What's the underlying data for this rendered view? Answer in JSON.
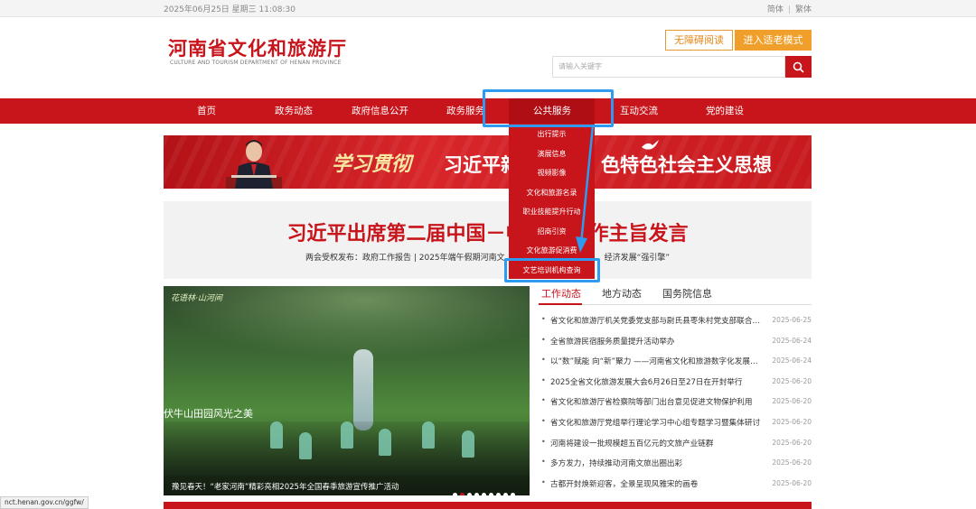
{
  "topbar": {
    "date": "2025年06月25日 星期三 11:08:30",
    "lang_simplified": "简体",
    "lang_separator": "|",
    "lang_traditional": "繁体"
  },
  "header": {
    "title": "河南省文化和旅游厅",
    "subtitle": "CULTURE AND TOURISM DEPARTMENT OF HENAN PROVINCE",
    "accessible_btn": "无障碍阅读",
    "elder_btn": "进入适老模式",
    "search_placeholder": "请输入关键字",
    "search_icon": "search-icon"
  },
  "nav": {
    "items": [
      "首页",
      "政务动态",
      "政府信息公开",
      "政务服务",
      "公共服务",
      "互动交流",
      "党的建设"
    ],
    "active": "公共服务"
  },
  "dropdown": {
    "items": [
      "出行提示",
      "演展信息",
      "视频影像",
      "文化和旅游名录",
      "职业技能提升行动",
      "招商引资",
      "文化旅游促消费",
      "文艺培训机构查询"
    ],
    "highlighted": "文艺培训机构查询"
  },
  "banner": {
    "calligraphy": "学习贯彻",
    "slogan_left": "习近平新",
    "slogan_right": "色特色社会主义思想"
  },
  "headline": {
    "title_left": "习近平出席第二届中国－中",
    "title_right": "工作主旨发言",
    "sub_left": "两会受权发布：政府工作报告 | 2025年端午假期河南文",
    "sub_right": "经济发展“强引擎”"
  },
  "slider": {
    "overlay_tag": "花语林·山河间",
    "caption_script": "伏牛山田园风光之美",
    "caption": "豫见春天！“老家河南”精彩亮相2025年全国春季旅游宣传推广活动",
    "dots": 9,
    "active_dot": 1
  },
  "news": {
    "tabs": [
      "工作动态",
      "地方动态",
      "国务院信息"
    ],
    "active_tab": "工作动态",
    "items": [
      {
        "title": "省文化和旅游厅机关党委党支部与尉氏县枣朱村党支部联合开展主题党日活动",
        "date": "2025-06-25"
      },
      {
        "title": "全省旅游民宿服务质量提升活动举办",
        "date": "2025-06-24"
      },
      {
        "title": "以“数”赋能 向“新”聚力 ——河南省文化和旅游数字化发展大会举行",
        "date": "2025-06-24"
      },
      {
        "title": "2025全省文化旅游发展大会6月26日至27日在开封举行",
        "date": "2025-06-20"
      },
      {
        "title": "省文化和旅游厅省检察院等部门出台意见促进文物保护利用",
        "date": "2025-06-20"
      },
      {
        "title": "省文化和旅游厅党组举行理论学习中心组专题学习暨集体研讨",
        "date": "2025-06-20"
      },
      {
        "title": "河南将建设一批规模超五百亿元的文旅产业链群",
        "date": "2025-06-20"
      },
      {
        "title": "多方发力，持续推动河南文旅出圈出彩",
        "date": "2025-06-20"
      },
      {
        "title": "古都开封焕新迎客，全景呈现风雅宋的画卷",
        "date": "2025-06-20"
      }
    ]
  },
  "status_url": "nct.henan.gov.cn/ggfw/",
  "colors": {
    "brand_red": "#c8141b",
    "accent_orange": "#f0a02a",
    "highlight_blue": "#2e9bf0"
  }
}
